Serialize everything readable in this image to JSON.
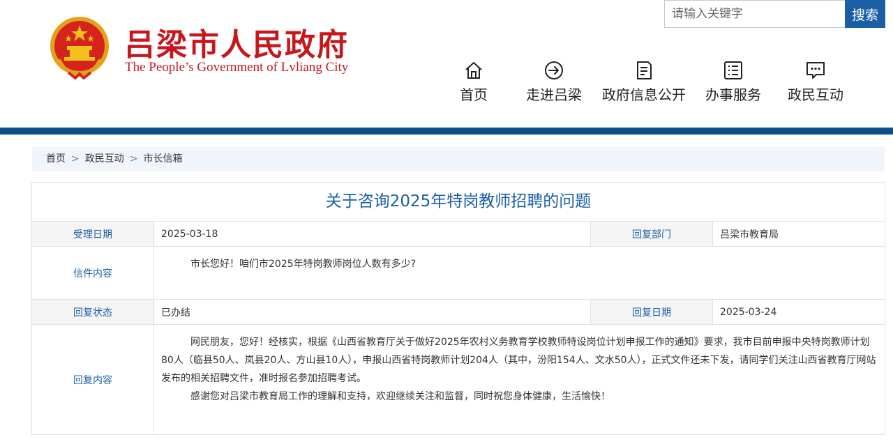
{
  "header": {
    "title_cn": "吕梁市人民政府",
    "title_en": "The People’s Government of Lvliang City",
    "emblem_icon": "national-emblem-icon"
  },
  "search": {
    "placeholder": "请输入关键字",
    "button_label": "搜索"
  },
  "nav": {
    "items": [
      {
        "label": "首页",
        "icon": "home-icon"
      },
      {
        "label": "走进吕梁",
        "icon": "arrow-circle-icon"
      },
      {
        "label": "政府信息公开",
        "icon": "document-icon"
      },
      {
        "label": "办事服务",
        "icon": "list-icon"
      },
      {
        "label": "政民互动",
        "icon": "chat-icon"
      }
    ]
  },
  "breadcrumb": {
    "items": [
      "首页",
      "政民互动",
      "市长信箱"
    ],
    "separator": ">"
  },
  "letter": {
    "title": "关于咨询2025年特岗教师招聘的问题",
    "accept_date_label": "受理日期",
    "accept_date": "2025-03-18",
    "reply_dept_label": "回复部门",
    "reply_dept": "吕梁市教育局",
    "content_label": "信件内容",
    "content": "市长您好！咱们市2025年特岗教师岗位人数有多少?",
    "status_label": "回复状态",
    "status": "已办结",
    "reply_date_label": "回复日期",
    "reply_date": "2025-03-24",
    "reply_label": "回复内容",
    "reply_paragraphs": [
      "网民朋友，您好！经核实，根据《山西省教育厅关于做好2025年农村义务教育学校教师特设岗位计划申报工作的通知》要求，我市目前申报中央特岗教师计划80人（临县50人、岚县20人、方山县10人），申报山西省特岗教师计划204人（其中，汾阳154人、文水50人），正式文件还未下发，请同学们关注山西省教育厅网站发布的相关招聘文件，准时报名参加招聘考试。",
      "感谢您对吕梁市教育局工作的理解和支持，欢迎继续关注和监督，同时祝您身体健康，生活愉快！"
    ]
  },
  "colors": {
    "brand_red": "#c8161d",
    "brand_blue": "#0f4d8d",
    "link_blue": "#1a5fa5"
  }
}
